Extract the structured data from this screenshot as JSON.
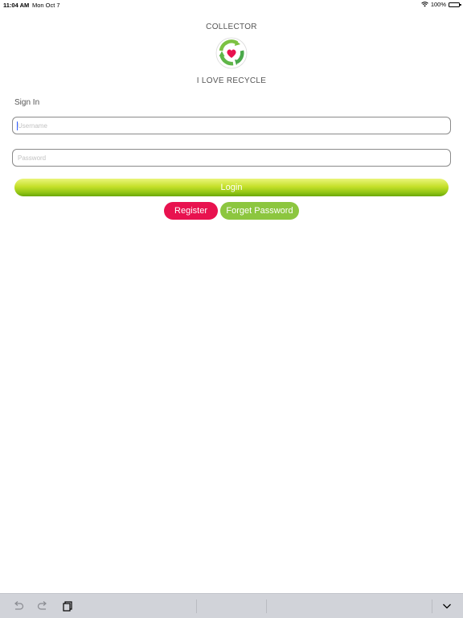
{
  "status_bar": {
    "time": "11:04 AM",
    "date": "Mon Oct 7",
    "battery_percent": "100%",
    "icons": [
      "wifi-icon",
      "battery-icon"
    ]
  },
  "header": {
    "title": "COLLECTOR",
    "subtitle": "I LOVE RECYCLE",
    "logo_icon": "recycle-heart-logo"
  },
  "form": {
    "section_label": "Sign In",
    "username": {
      "value": "",
      "placeholder": "Username"
    },
    "password": {
      "value": "",
      "placeholder": "Password"
    }
  },
  "buttons": {
    "login": "Login",
    "register": "Register",
    "forgot": "Forget Password"
  },
  "colors": {
    "login_green": "#8fc414",
    "register_red": "#e8124f",
    "forgot_green": "#8cc63f"
  },
  "keyboard_toolbar": {
    "icons": [
      "undo-icon",
      "redo-icon",
      "paste-icon",
      "dismiss-keyboard-icon"
    ]
  }
}
